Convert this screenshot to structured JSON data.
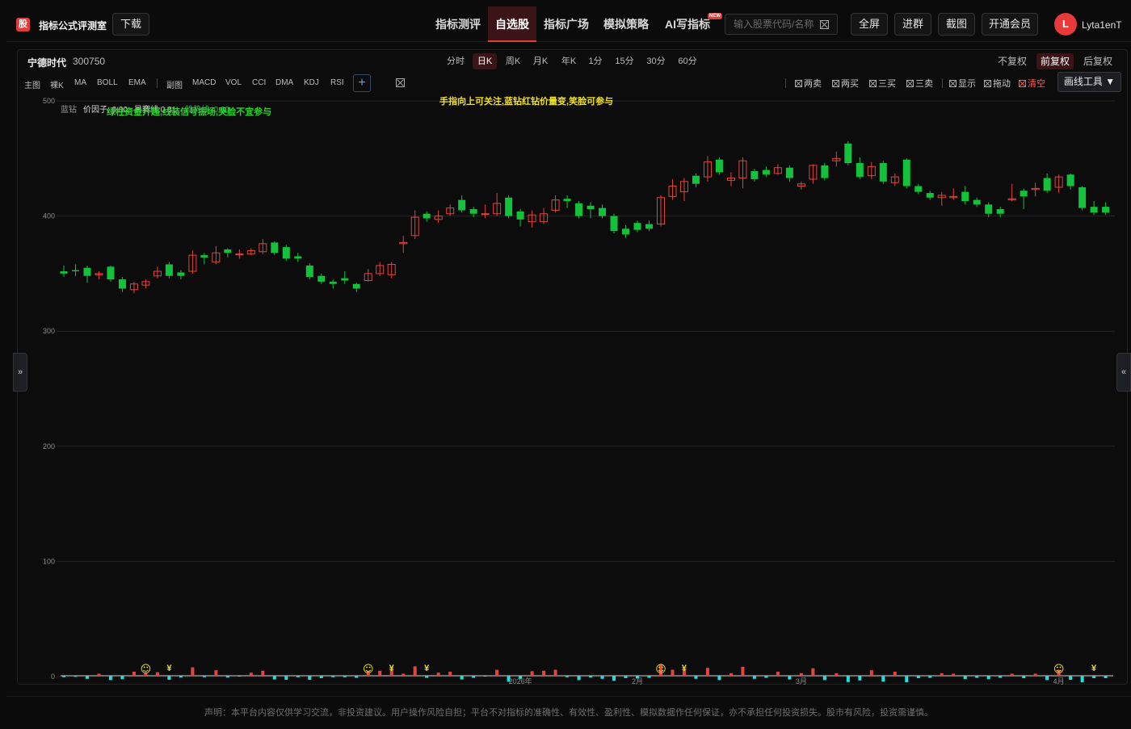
{
  "header": {
    "logo_char": "股",
    "app_title": "指标公式评测室",
    "download_label": "下载",
    "nav": [
      {
        "label": "指标测评",
        "active": false
      },
      {
        "label": "自选股",
        "active": true
      },
      {
        "label": "指标广场",
        "active": false
      },
      {
        "label": "模拟策略",
        "active": false
      },
      {
        "label": "AI写指标",
        "active": false,
        "badge": "NEW"
      }
    ],
    "search_placeholder": "输入股票代码/名称",
    "fullscreen_label": "全屏",
    "join_group_label": "进群",
    "screenshot_label": "截图",
    "membership_label": "开通会员",
    "avatar_letter": "L",
    "username": "Lyta1enT"
  },
  "stock": {
    "name": "宁德时代",
    "code": "300750"
  },
  "timeframes": [
    {
      "label": "分时",
      "active": false
    },
    {
      "label": "日K",
      "active": true
    },
    {
      "label": "周K",
      "active": false
    },
    {
      "label": "月K",
      "active": false
    },
    {
      "label": "年K",
      "active": false
    },
    {
      "label": "1分",
      "active": false
    },
    {
      "label": "15分",
      "active": false
    },
    {
      "label": "30分",
      "active": false
    },
    {
      "label": "60分",
      "active": false
    }
  ],
  "adjust": [
    {
      "label": "不复权",
      "active": false
    },
    {
      "label": "前复权",
      "active": true
    },
    {
      "label": "后复权",
      "active": false
    }
  ],
  "indicators_main_label": "主图",
  "indicators_main": [
    "裸K",
    "MA",
    "BOLL",
    "EMA"
  ],
  "indicators_sub_label": "副图",
  "indicators_sub": [
    "MACD",
    "VOL",
    "CCI",
    "DMA",
    "KDJ",
    "RSI"
  ],
  "add_indicator": "+",
  "signals": [
    {
      "label": "两卖",
      "red": false
    },
    {
      "label": "两买",
      "red": false
    },
    {
      "label": "三买",
      "red": false
    },
    {
      "label": "三卖",
      "red": false
    },
    {
      "label": "显示",
      "red": false
    },
    {
      "label": "拖动",
      "red": false
    },
    {
      "label": "清空",
      "red": true
    }
  ],
  "draw_tools_label": "画线工具 ▼",
  "legend": {
    "indicator": "蓝钻",
    "price_factor": "价因子: 0.00",
    "trend_line": "暑赛线:0.81",
    "hidden_value": "趋势线: 0.00",
    "green_hint": "绿柱资金开超,线装信号振场,哭脸不宜参与",
    "yellow_hint": "手指向上可关注,蓝钻红钻价量变,笑脸可参与"
  },
  "side_left": "»",
  "side_right": "«",
  "footer": "声明：本平台内容仅供学习交流，非投资建议。用户操作风险自担；平台不对指标的准确性、有效性、盈利性、模拟数据作任何保证，亦不承担任何投资损失。股市有风险，投资需谨慎。",
  "colors": {
    "up": "#e0453f",
    "down": "#13c13b",
    "accent": "#e03c3c",
    "volume": "#22e0e0",
    "hint_green": "#2ad32a",
    "hint_yellow": "#f2e21c"
  },
  "chart_data": {
    "type": "candlestick",
    "ylim": [
      0,
      500
    ],
    "y_ticks": [
      0,
      100,
      200,
      300,
      400,
      500
    ],
    "x_labels": [
      {
        "label": "2026年",
        "index": 39
      },
      {
        "label": "2月",
        "index": 49
      },
      {
        "label": "3月",
        "index": 63
      },
      {
        "label": "4月",
        "index": 85
      }
    ],
    "candles": [
      {
        "o": 352,
        "c": 350,
        "h": 357,
        "l": 347
      },
      {
        "o": 353,
        "c": 352,
        "h": 358,
        "l": 348
      },
      {
        "o": 355,
        "c": 348,
        "h": 357,
        "l": 342
      },
      {
        "o": 349,
        "c": 350,
        "h": 352,
        "l": 345
      },
      {
        "o": 356,
        "c": 345,
        "h": 357,
        "l": 343
      },
      {
        "o": 345,
        "c": 337,
        "h": 347,
        "l": 334
      },
      {
        "o": 336,
        "c": 341,
        "h": 343,
        "l": 333
      },
      {
        "o": 340,
        "c": 343,
        "h": 345,
        "l": 337
      },
      {
        "o": 348,
        "c": 352,
        "h": 356,
        "l": 346
      },
      {
        "o": 358,
        "c": 348,
        "h": 360,
        "l": 346
      },
      {
        "o": 351,
        "c": 348,
        "h": 353,
        "l": 345
      },
      {
        "o": 352,
        "c": 366,
        "h": 370,
        "l": 350
      },
      {
        "o": 366,
        "c": 364,
        "h": 368,
        "l": 358
      },
      {
        "o": 360,
        "c": 368,
        "h": 374,
        "l": 358
      },
      {
        "o": 371,
        "c": 368,
        "h": 372,
        "l": 364
      },
      {
        "o": 367,
        "c": 367,
        "h": 371,
        "l": 363
      },
      {
        "o": 367,
        "c": 370,
        "h": 372,
        "l": 366
      },
      {
        "o": 369,
        "c": 376,
        "h": 380,
        "l": 367
      },
      {
        "o": 377,
        "c": 368,
        "h": 378,
        "l": 366
      },
      {
        "o": 373,
        "c": 363,
        "h": 375,
        "l": 361
      },
      {
        "o": 365,
        "c": 363,
        "h": 368,
        "l": 360
      },
      {
        "o": 357,
        "c": 347,
        "h": 359,
        "l": 345
      },
      {
        "o": 348,
        "c": 343,
        "h": 350,
        "l": 341
      },
      {
        "o": 343,
        "c": 341,
        "h": 345,
        "l": 337
      },
      {
        "o": 346,
        "c": 344,
        "h": 352,
        "l": 341
      },
      {
        "o": 341,
        "c": 337,
        "h": 342,
        "l": 334
      },
      {
        "o": 344,
        "c": 350,
        "h": 354,
        "l": 343
      },
      {
        "o": 350,
        "c": 357,
        "h": 360,
        "l": 348
      },
      {
        "o": 349,
        "c": 358,
        "h": 360,
        "l": 346
      },
      {
        "o": 376,
        "c": 377,
        "h": 383,
        "l": 368
      },
      {
        "o": 383,
        "c": 399,
        "h": 405,
        "l": 380
      },
      {
        "o": 402,
        "c": 398,
        "h": 404,
        "l": 395
      },
      {
        "o": 397,
        "c": 400,
        "h": 405,
        "l": 394
      },
      {
        "o": 402,
        "c": 407,
        "h": 410,
        "l": 400
      },
      {
        "o": 414,
        "c": 405,
        "h": 418,
        "l": 403
      },
      {
        "o": 406,
        "c": 402,
        "h": 408,
        "l": 399
      },
      {
        "o": 402,
        "c": 402,
        "h": 410,
        "l": 398
      },
      {
        "o": 402,
        "c": 411,
        "h": 420,
        "l": 400
      },
      {
        "o": 416,
        "c": 400,
        "h": 418,
        "l": 398
      },
      {
        "o": 404,
        "c": 397,
        "h": 406,
        "l": 391
      },
      {
        "o": 395,
        "c": 401,
        "h": 405,
        "l": 390
      },
      {
        "o": 395,
        "c": 402,
        "h": 407,
        "l": 393
      },
      {
        "o": 405,
        "c": 414,
        "h": 418,
        "l": 403
      },
      {
        "o": 415,
        "c": 413,
        "h": 418,
        "l": 407
      },
      {
        "o": 411,
        "c": 400,
        "h": 413,
        "l": 398
      },
      {
        "o": 409,
        "c": 406,
        "h": 412,
        "l": 398
      },
      {
        "o": 407,
        "c": 400,
        "h": 410,
        "l": 398
      },
      {
        "o": 400,
        "c": 387,
        "h": 402,
        "l": 385
      },
      {
        "o": 389,
        "c": 384,
        "h": 392,
        "l": 381
      },
      {
        "o": 394,
        "c": 388,
        "h": 396,
        "l": 386
      },
      {
        "o": 393,
        "c": 389,
        "h": 396,
        "l": 387
      },
      {
        "o": 393,
        "c": 416,
        "h": 418,
        "l": 391
      },
      {
        "o": 417,
        "c": 426,
        "h": 432,
        "l": 414
      },
      {
        "o": 421,
        "c": 430,
        "h": 433,
        "l": 413
      },
      {
        "o": 435,
        "c": 428,
        "h": 437,
        "l": 425
      },
      {
        "o": 434,
        "c": 447,
        "h": 452,
        "l": 430
      },
      {
        "o": 449,
        "c": 438,
        "h": 451,
        "l": 436
      },
      {
        "o": 431,
        "c": 433,
        "h": 438,
        "l": 426
      },
      {
        "o": 433,
        "c": 448,
        "h": 451,
        "l": 424
      },
      {
        "o": 439,
        "c": 432,
        "h": 441,
        "l": 430
      },
      {
        "o": 440,
        "c": 436,
        "h": 443,
        "l": 434
      },
      {
        "o": 437,
        "c": 442,
        "h": 445,
        "l": 436
      },
      {
        "o": 442,
        "c": 433,
        "h": 444,
        "l": 430
      },
      {
        "o": 426,
        "c": 428,
        "h": 430,
        "l": 423
      },
      {
        "o": 432,
        "c": 444,
        "h": 445,
        "l": 428
      },
      {
        "o": 444,
        "c": 433,
        "h": 446,
        "l": 431
      },
      {
        "o": 448,
        "c": 450,
        "h": 456,
        "l": 443
      },
      {
        "o": 463,
        "c": 446,
        "h": 465,
        "l": 444
      },
      {
        "o": 446,
        "c": 434,
        "h": 451,
        "l": 432
      },
      {
        "o": 435,
        "c": 443,
        "h": 447,
        "l": 432
      },
      {
        "o": 446,
        "c": 430,
        "h": 448,
        "l": 428
      },
      {
        "o": 429,
        "c": 434,
        "h": 437,
        "l": 426
      },
      {
        "o": 449,
        "c": 426,
        "h": 450,
        "l": 424
      },
      {
        "o": 426,
        "c": 421,
        "h": 428,
        "l": 419
      },
      {
        "o": 420,
        "c": 416,
        "h": 422,
        "l": 414
      },
      {
        "o": 416,
        "c": 418,
        "h": 421,
        "l": 409
      },
      {
        "o": 416,
        "c": 417,
        "h": 424,
        "l": 414
      },
      {
        "o": 421,
        "c": 413,
        "h": 426,
        "l": 410
      },
      {
        "o": 414,
        "c": 410,
        "h": 416,
        "l": 408
      },
      {
        "o": 410,
        "c": 402,
        "h": 412,
        "l": 399
      },
      {
        "o": 406,
        "c": 402,
        "h": 408,
        "l": 399
      },
      {
        "o": 414,
        "c": 415,
        "h": 428,
        "l": 413
      },
      {
        "o": 422,
        "c": 417,
        "h": 424,
        "l": 406
      },
      {
        "o": 423,
        "c": 424,
        "h": 429,
        "l": 417
      },
      {
        "o": 433,
        "c": 422,
        "h": 437,
        "l": 420
      },
      {
        "o": 425,
        "c": 434,
        "h": 436,
        "l": 420
      },
      {
        "o": 436,
        "c": 426,
        "h": 437,
        "l": 423
      },
      {
        "o": 425,
        "c": 407,
        "h": 426,
        "l": 405
      },
      {
        "o": 408,
        "c": 403,
        "h": 413,
        "l": 401
      },
      {
        "o": 408,
        "c": 403,
        "h": 412,
        "l": 401
      }
    ],
    "smiley_at": [
      7,
      26,
      51,
      85
    ],
    "yen_at": [
      9,
      28,
      31,
      53,
      88
    ]
  }
}
